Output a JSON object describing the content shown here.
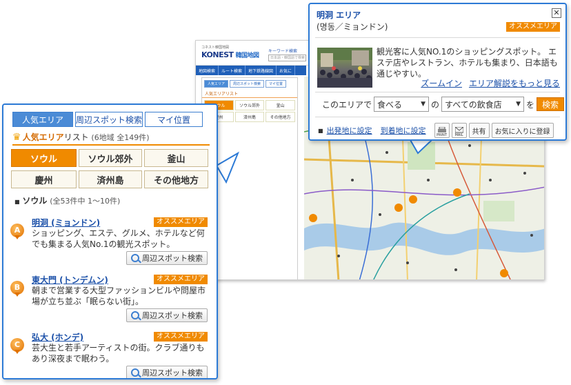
{
  "bg_page": {
    "logo_small": "コネスト韓国地図",
    "logo": "KONEST",
    "logo_suffix": "韓国地図",
    "keyword_label": "キーワード検索",
    "keyword_placeholder": "日本語・韓国語で検索",
    "nav": [
      "地図検索",
      "ルート検索",
      "地下鉄路線図",
      "お気に"
    ],
    "mini_tabs": [
      "人気エリア",
      "周辺スポット検索",
      "マイ位置"
    ],
    "mini_title": "人気エリアリスト",
    "mini_regions": [
      "ソウル",
      "ソウル郊外",
      "釜山",
      "慶州",
      "済州島",
      "その他地方"
    ]
  },
  "popup": {
    "title": "明洞 エリア",
    "subtitle": "(명동／ミョンドン)",
    "badge": "オススメエリア",
    "close_symbol": "✕",
    "description": "観光客に人気NO.1のショッピングスポット。 エステ店やレストラン、ホテルも集まり、日本語も通じやすい。",
    "link_zoom": "ズームイン",
    "link_more": "エリア解説をもっと見る",
    "form_prefix": "このエリアで",
    "select_action": "食べる",
    "form_particle": "の",
    "select_category": "すべての飲食店",
    "form_particle2": "を",
    "search_button": "検索",
    "set_origin": "出発地に設定",
    "set_destination": "到着地に設定",
    "print_label": "PRINT",
    "mail_label": "MAIL",
    "share_label": "共有",
    "favorite_label": "お気に入りに登録"
  },
  "panel": {
    "tabs": [
      "人気エリア",
      "周辺スポット検索",
      "マイ位置"
    ],
    "list_title_orange": "人気エリア",
    "list_title_rest": "リスト",
    "list_count": "(6地域 全149件)",
    "regions": [
      "ソウル",
      "ソウル郊外",
      "釜山",
      "慶州",
      "済州島",
      "その他地方"
    ],
    "section_name": "ソウル",
    "section_count": "(全53件中 1～10件)",
    "items": [
      {
        "marker": "A",
        "title": "明洞 (ミョンドン)",
        "badge": "オススメエリア",
        "desc": "ショッピング、エステ、グルメ、ホテルなど何でも集まる人気No.1の観光スポット。",
        "button": "周辺スポット検索"
      },
      {
        "marker": "B",
        "title": "東大門 (トンデムン)",
        "badge": "オススメエリア",
        "desc": "朝まで営業する大型ファッションビルや問屋市場が立ち並ぶ「眠らない街」。",
        "button": "周辺スポット検索"
      },
      {
        "marker": "C",
        "title": "弘大 (ホンデ)",
        "badge": "オススメエリア",
        "desc": "芸大生と若手アーティストの街。クラブ通りもあり深夜まで眠わう。",
        "button": "周辺スポット検索"
      }
    ]
  },
  "colors": {
    "accent_blue": "#2c7ad6",
    "accent_orange": "#f08a00",
    "link": "#1a4fa8"
  }
}
